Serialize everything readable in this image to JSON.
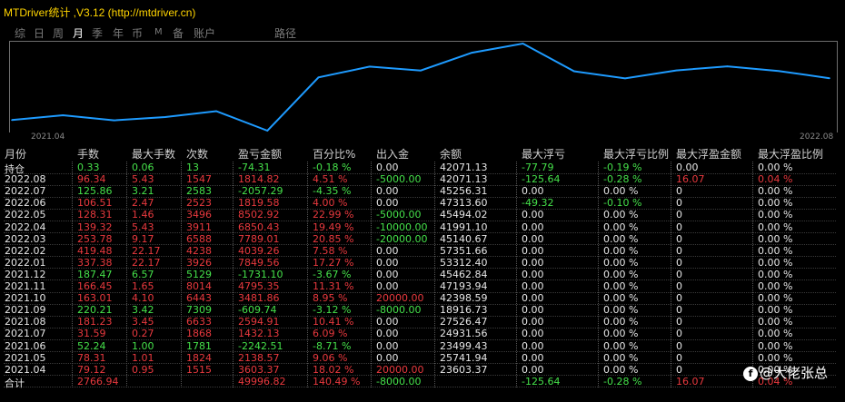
{
  "window": {
    "title": "MTDriver统计 ,V3.12 (http://mtdriver.cn)"
  },
  "toolbar": {
    "items": [
      "综",
      "日",
      "周",
      "月",
      "季",
      "年",
      "币",
      "M",
      "备",
      "账户",
      "路径"
    ],
    "active": "月"
  },
  "chart_data": {
    "type": "line",
    "x_start_label": "2021.04",
    "x_end_label": "2022.08",
    "x": [
      "2021.04",
      "2021.05",
      "2021.06",
      "2021.07",
      "2021.08",
      "2021.09",
      "2021.10",
      "2021.11",
      "2021.12",
      "2022.01",
      "2022.02",
      "2022.03",
      "2022.04",
      "2022.05",
      "2022.06",
      "2022.07",
      "2022.08"
    ],
    "series": [
      {
        "values": [
          23603.37,
          25741.94,
          23499.43,
          24931.56,
          27526.47,
          18916.73,
          42398.59,
          47193.94,
          45462.84,
          53312.4,
          57351.66,
          45140.67,
          41991.1,
          45494.02,
          47313.6,
          45256.31,
          42071.13
        ]
      }
    ],
    "color": "#1e9bff"
  },
  "table": {
    "headers": [
      "月份",
      "手数",
      "最大手数",
      "次数",
      "盈亏金额",
      "百分比%",
      "出入金",
      "余额",
      "最大浮亏",
      "最大浮亏比例",
      "最大浮盈金额",
      "最大浮盈比例"
    ],
    "rows": [
      {
        "c": [
          "持仓",
          "0.33",
          "0.06",
          "13",
          "-74.31",
          "-0.18 %",
          "0.00",
          "42071.13",
          "-77.79",
          "-0.19 %",
          "0.00",
          "0.00 %"
        ],
        "k": [
          "w",
          "g",
          "g",
          "g",
          "g",
          "g",
          "w",
          "w",
          "g",
          "g",
          "w",
          "w"
        ]
      },
      {
        "c": [
          "2022.08",
          "96.34",
          "5.43",
          "1547",
          "1814.82",
          "4.51 %",
          "-5000.00",
          "42071.13",
          "-125.64",
          "-0.28 %",
          "16.07",
          "0.04 %"
        ],
        "k": [
          "w",
          "r",
          "r",
          "r",
          "r",
          "r",
          "g",
          "w",
          "g",
          "g",
          "r",
          "r"
        ]
      },
      {
        "c": [
          "2022.07",
          "125.86",
          "3.21",
          "2583",
          "-2057.29",
          "-4.35 %",
          "0.00",
          "45256.31",
          "0.00",
          "0.00 %",
          "0",
          "0.00 %"
        ],
        "k": [
          "w",
          "g",
          "g",
          "g",
          "g",
          "g",
          "w",
          "w",
          "w",
          "w",
          "w",
          "w"
        ]
      },
      {
        "c": [
          "2022.06",
          "106.51",
          "2.47",
          "2523",
          "1819.58",
          "4.00 %",
          "0.00",
          "47313.60",
          "-49.32",
          "-0.10 %",
          "0",
          "0.00 %"
        ],
        "k": [
          "w",
          "r",
          "r",
          "r",
          "r",
          "r",
          "w",
          "w",
          "g",
          "g",
          "w",
          "w"
        ]
      },
      {
        "c": [
          "2022.05",
          "128.31",
          "1.46",
          "3496",
          "8502.92",
          "22.99 %",
          "-5000.00",
          "45494.02",
          "0.00",
          "0.00 %",
          "0",
          "0.00 %"
        ],
        "k": [
          "w",
          "r",
          "r",
          "r",
          "r",
          "r",
          "g",
          "w",
          "w",
          "w",
          "w",
          "w"
        ]
      },
      {
        "c": [
          "2022.04",
          "139.32",
          "5.43",
          "3911",
          "6850.43",
          "19.49 %",
          "-10000.00",
          "41991.10",
          "0.00",
          "0.00 %",
          "0",
          "0.00 %"
        ],
        "k": [
          "w",
          "r",
          "r",
          "r",
          "r",
          "r",
          "g",
          "w",
          "w",
          "w",
          "w",
          "w"
        ]
      },
      {
        "c": [
          "2022.03",
          "253.78",
          "9.17",
          "6588",
          "7789.01",
          "20.85 %",
          "-20000.00",
          "45140.67",
          "0.00",
          "0.00 %",
          "0",
          "0.00 %"
        ],
        "k": [
          "w",
          "r",
          "r",
          "r",
          "r",
          "r",
          "g",
          "w",
          "w",
          "w",
          "w",
          "w"
        ]
      },
      {
        "c": [
          "2022.02",
          "419.48",
          "22.17",
          "4238",
          "4039.26",
          "7.58 %",
          "0.00",
          "57351.66",
          "0.00",
          "0.00 %",
          "0",
          "0.00 %"
        ],
        "k": [
          "w",
          "r",
          "r",
          "r",
          "r",
          "r",
          "w",
          "w",
          "w",
          "w",
          "w",
          "w"
        ]
      },
      {
        "c": [
          "2022.01",
          "337.38",
          "22.17",
          "3926",
          "7849.56",
          "17.27 %",
          "0.00",
          "53312.40",
          "0.00",
          "0.00 %",
          "0",
          "0.00 %"
        ],
        "k": [
          "w",
          "r",
          "r",
          "r",
          "r",
          "r",
          "w",
          "w",
          "w",
          "w",
          "w",
          "w"
        ]
      },
      {
        "c": [
          "2021.12",
          "187.47",
          "6.57",
          "5129",
          "-1731.10",
          "-3.67 %",
          "0.00",
          "45462.84",
          "0.00",
          "0.00 %",
          "0",
          "0.00 %"
        ],
        "k": [
          "w",
          "g",
          "g",
          "g",
          "g",
          "g",
          "w",
          "w",
          "w",
          "w",
          "w",
          "w"
        ]
      },
      {
        "c": [
          "2021.11",
          "166.45",
          "1.65",
          "8014",
          "4795.35",
          "11.31 %",
          "0.00",
          "47193.94",
          "0.00",
          "0.00 %",
          "0",
          "0.00 %"
        ],
        "k": [
          "w",
          "r",
          "r",
          "r",
          "r",
          "r",
          "w",
          "w",
          "w",
          "w",
          "w",
          "w"
        ]
      },
      {
        "c": [
          "2021.10",
          "163.01",
          "4.10",
          "6443",
          "3481.86",
          "8.95 %",
          "20000.00",
          "42398.59",
          "0.00",
          "0.00 %",
          "0",
          "0.00 %"
        ],
        "k": [
          "w",
          "r",
          "r",
          "r",
          "r",
          "r",
          "r",
          "w",
          "w",
          "w",
          "w",
          "w"
        ]
      },
      {
        "c": [
          "2021.09",
          "220.21",
          "3.42",
          "7309",
          "-609.74",
          "-3.12 %",
          "-8000.00",
          "18916.73",
          "0.00",
          "0.00 %",
          "0",
          "0.00 %"
        ],
        "k": [
          "w",
          "g",
          "g",
          "g",
          "g",
          "g",
          "g",
          "w",
          "w",
          "w",
          "w",
          "w"
        ]
      },
      {
        "c": [
          "2021.08",
          "181.23",
          "3.45",
          "6633",
          "2594.91",
          "10.41 %",
          "0.00",
          "27526.47",
          "0.00",
          "0.00 %",
          "0",
          "0.00 %"
        ],
        "k": [
          "w",
          "r",
          "r",
          "r",
          "r",
          "r",
          "w",
          "w",
          "w",
          "w",
          "w",
          "w"
        ]
      },
      {
        "c": [
          "2021.07",
          "31.59",
          "0.27",
          "1868",
          "1432.13",
          "6.09 %",
          "0.00",
          "24931.56",
          "0.00",
          "0.00 %",
          "0",
          "0.00 %"
        ],
        "k": [
          "w",
          "r",
          "r",
          "r",
          "r",
          "r",
          "w",
          "w",
          "w",
          "w",
          "w",
          "w"
        ]
      },
      {
        "c": [
          "2021.06",
          "52.24",
          "1.00",
          "1781",
          "-2242.51",
          "-8.71 %",
          "0.00",
          "23499.43",
          "0.00",
          "0.00 %",
          "0",
          "0.00 %"
        ],
        "k": [
          "w",
          "g",
          "g",
          "g",
          "g",
          "g",
          "w",
          "w",
          "w",
          "w",
          "w",
          "w"
        ]
      },
      {
        "c": [
          "2021.05",
          "78.31",
          "1.01",
          "1824",
          "2138.57",
          "9.06 %",
          "0.00",
          "25741.94",
          "0.00",
          "0.00 %",
          "0",
          "0.00 %"
        ],
        "k": [
          "w",
          "r",
          "r",
          "r",
          "r",
          "r",
          "w",
          "w",
          "w",
          "w",
          "w",
          "w"
        ]
      },
      {
        "c": [
          "2021.04",
          "79.12",
          "0.95",
          "1515",
          "3603.37",
          "18.02 %",
          "20000.00",
          "23603.37",
          "0.00",
          "0.00 %",
          "0",
          "0.00 %"
        ],
        "k": [
          "w",
          "r",
          "r",
          "r",
          "r",
          "r",
          "r",
          "w",
          "w",
          "w",
          "w",
          "w"
        ]
      },
      {
        "c": [
          "合计",
          "2766.94",
          "",
          "",
          "49996.82",
          "140.49 %",
          "-8000.00",
          "",
          "-125.64",
          "-0.28 %",
          "16.07",
          "0.04 %"
        ],
        "k": [
          "w",
          "r",
          "w",
          "w",
          "r",
          "r",
          "g",
          "w",
          "g",
          "g",
          "r",
          "r"
        ]
      }
    ]
  },
  "watermark": {
    "text": "@大佬张总"
  }
}
